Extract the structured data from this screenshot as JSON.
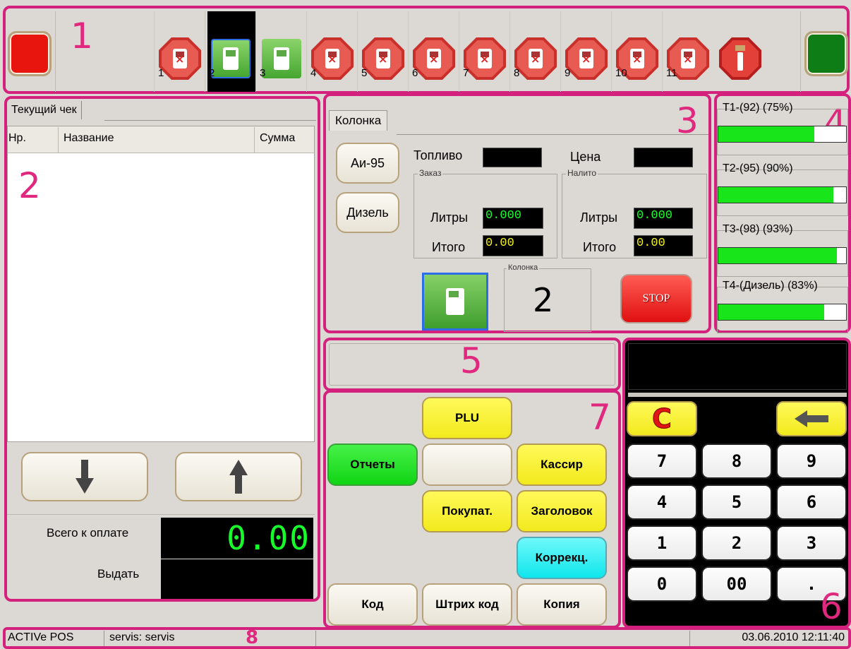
{
  "regions": [
    "1",
    "2",
    "3",
    "4",
    "5",
    "6",
    "7",
    "8"
  ],
  "top_bar": {
    "left_button_color": "#e8150f",
    "right_button_color": "#0e7d16",
    "pumps": [
      {
        "number": "1",
        "state": "blocked"
      },
      {
        "number": "2",
        "state": "selected"
      },
      {
        "number": "3",
        "state": "available"
      },
      {
        "number": "4",
        "state": "blocked"
      },
      {
        "number": "5",
        "state": "blocked"
      },
      {
        "number": "6",
        "state": "blocked"
      },
      {
        "number": "7",
        "state": "blocked"
      },
      {
        "number": "8",
        "state": "blocked"
      },
      {
        "number": "9",
        "state": "blocked"
      },
      {
        "number": "10",
        "state": "blocked"
      },
      {
        "number": "11",
        "state": "blocked"
      }
    ],
    "info_icon": "stop-info-icon"
  },
  "receipt": {
    "tab_label": "Текущий чек",
    "columns": {
      "num": "Нр.",
      "name": "Название",
      "sum": "Сумма"
    },
    "total_label": "Всего к оплате",
    "total_value": "0.00",
    "change_label": "Выдать",
    "change_value": ""
  },
  "pump_panel": {
    "tab_label": "Колонка",
    "fuel_buttons": [
      "Аи-95",
      "Дизель"
    ],
    "fuel_label": "Топливо",
    "price_label": "Цена",
    "order_caption": "Заказ",
    "poured_caption": "Налито",
    "liters_label": "Литры",
    "total_label": "Итого",
    "order_liters": "0.000",
    "order_total": "0.00",
    "poured_liters": "0.000",
    "poured_total": "0.00",
    "pump_caption": "Колонка",
    "pump_number": "2",
    "stop_label": "STOP"
  },
  "tanks": [
    {
      "label": "T1-(92) (75%)",
      "level": 0.75
    },
    {
      "label": "T2-(95) (90%)",
      "level": 0.9
    },
    {
      "label": "T3-(98) (93%)",
      "level": 0.93
    },
    {
      "label": "T4-(Дизель) (83%)",
      "level": 0.83
    }
  ],
  "function_keys": {
    "plu": "PLU",
    "reports": "Отчеты",
    "blank": "",
    "cashier": "Кассир",
    "buyer": "Покупат.",
    "header": "Заголовок",
    "correction": "Коррекц.",
    "code": "Код",
    "barcode": "Штрих код",
    "copy": "Копия"
  },
  "keypad": {
    "clear": "C",
    "backspace_icon": "arrow-left-icon",
    "keys": [
      "7",
      "8",
      "9",
      "4",
      "5",
      "6",
      "1",
      "2",
      "3",
      "0",
      "00",
      "."
    ]
  },
  "status_bar": {
    "app": "ACTIVe POS",
    "user": "servis: servis",
    "datetime": "03.06.2010 12:11:40"
  },
  "colors": {
    "accent_region": "#d4217d",
    "yellow_key": "#f7ef2b",
    "green_key": "#10e514",
    "cyan_key": "#0ff2f5",
    "lcd_green": "#16ff2a",
    "lcd_yellow": "#f5f21c"
  }
}
